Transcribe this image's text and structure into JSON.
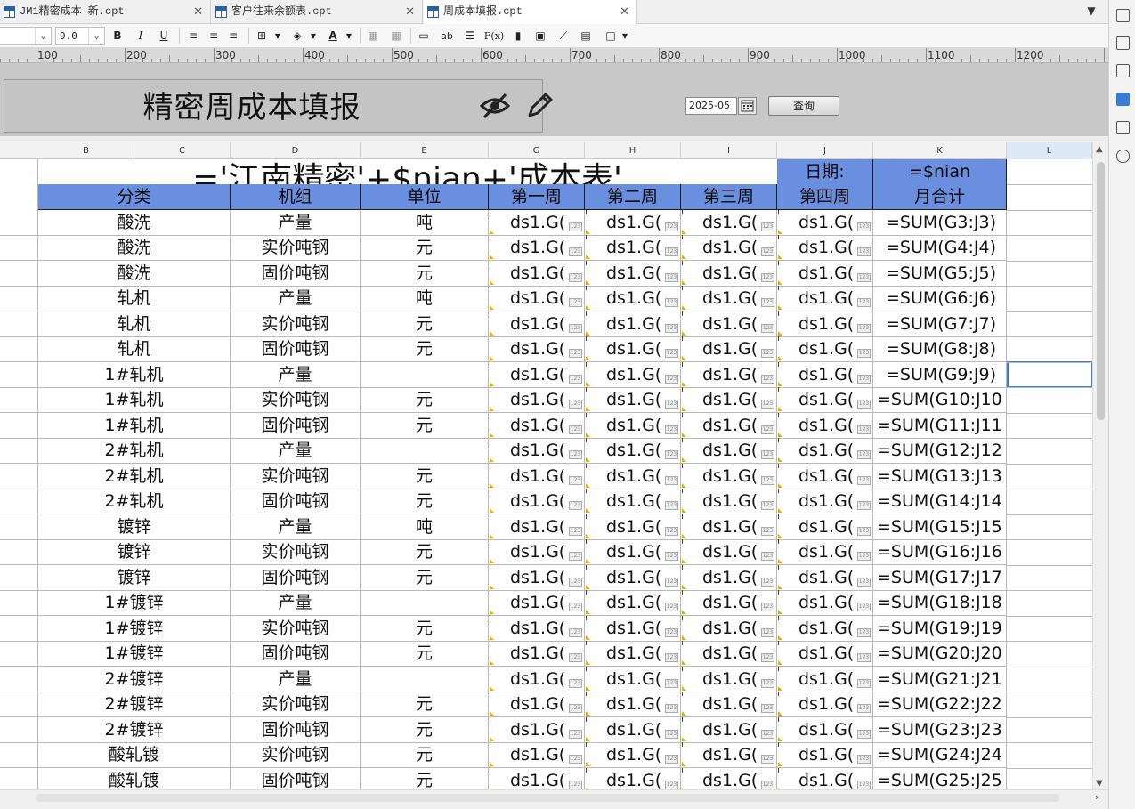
{
  "tabs": [
    {
      "label": "JM1精密成本 新.cpt",
      "close": "✕"
    },
    {
      "label": "客户往来余额表.cpt",
      "close": "✕"
    },
    {
      "label": "周成本填报.cpt",
      "close": "✕"
    }
  ],
  "toolbar": {
    "font_size": "9.0",
    "bold": "B",
    "italic": "I",
    "underline": "U",
    "font_color": "A",
    "text_ab": "ab",
    "formula": "F(x)"
  },
  "ruler": [
    "100",
    "200",
    "300",
    "400",
    "500",
    "600",
    "700",
    "800",
    "900",
    "1000",
    "1100",
    "1200"
  ],
  "param": {
    "title": "精密周成本填报",
    "date_value": "2025-05",
    "query_label": "查询"
  },
  "columns": [
    "B",
    "C",
    "D",
    "E",
    "G",
    "H",
    "I",
    "J",
    "K",
    "L"
  ],
  "sheet": {
    "title_formula": "='江南精密'+$nian+'成本表'",
    "date_label": "日期:",
    "date_formula": "=$nian",
    "headers": [
      "分类",
      "机组",
      "单位",
      "第一周",
      "第二周",
      "第三周",
      "第四周",
      "月合计"
    ],
    "cell_value": "ds1.G(",
    "badge": "123",
    "rows": [
      {
        "cat": "酸洗",
        "item": "产量",
        "unit": "吨",
        "sum": "=SUM(G3:J3)"
      },
      {
        "cat": "酸洗",
        "item": "实价吨钢",
        "unit": "元",
        "sum": "=SUM(G4:J4)"
      },
      {
        "cat": "酸洗",
        "item": "固价吨钢",
        "unit": "元",
        "sum": "=SUM(G5:J5)"
      },
      {
        "cat": "轧机",
        "item": "产量",
        "unit": "吨",
        "sum": "=SUM(G6:J6)"
      },
      {
        "cat": "轧机",
        "item": "实价吨钢",
        "unit": "元",
        "sum": "=SUM(G7:J7)"
      },
      {
        "cat": "轧机",
        "item": "固价吨钢",
        "unit": "元",
        "sum": "=SUM(G8:J8)"
      },
      {
        "cat": "1#轧机",
        "item": "产量",
        "unit": "",
        "sum": "=SUM(G9:J9)"
      },
      {
        "cat": "1#轧机",
        "item": "实价吨钢",
        "unit": "元",
        "sum": "=SUM(G10:J10"
      },
      {
        "cat": "1#轧机",
        "item": "固价吨钢",
        "unit": "元",
        "sum": "=SUM(G11:J11"
      },
      {
        "cat": "2#轧机",
        "item": "产量",
        "unit": "",
        "sum": "=SUM(G12:J12"
      },
      {
        "cat": "2#轧机",
        "item": "实价吨钢",
        "unit": "元",
        "sum": "=SUM(G13:J13"
      },
      {
        "cat": "2#轧机",
        "item": "固价吨钢",
        "unit": "元",
        "sum": "=SUM(G14:J14"
      },
      {
        "cat": "镀锌",
        "item": "产量",
        "unit": "吨",
        "sum": "=SUM(G15:J15"
      },
      {
        "cat": "镀锌",
        "item": "实价吨钢",
        "unit": "元",
        "sum": "=SUM(G16:J16"
      },
      {
        "cat": "镀锌",
        "item": "固价吨钢",
        "unit": "元",
        "sum": "=SUM(G17:J17"
      },
      {
        "cat": "1#镀锌",
        "item": "产量",
        "unit": "",
        "sum": "=SUM(G18:J18"
      },
      {
        "cat": "1#镀锌",
        "item": "实价吨钢",
        "unit": "元",
        "sum": "=SUM(G19:J19"
      },
      {
        "cat": "1#镀锌",
        "item": "固价吨钢",
        "unit": "元",
        "sum": "=SUM(G20:J20"
      },
      {
        "cat": "2#镀锌",
        "item": "产量",
        "unit": "",
        "sum": "=SUM(G21:J21"
      },
      {
        "cat": "2#镀锌",
        "item": "实价吨钢",
        "unit": "元",
        "sum": "=SUM(G22:J22"
      },
      {
        "cat": "2#镀锌",
        "item": "固价吨钢",
        "unit": "元",
        "sum": "=SUM(G23:J23"
      },
      {
        "cat": "酸轧镀",
        "item": "实价吨钢",
        "unit": "元",
        "sum": "=SUM(G24:J24"
      },
      {
        "cat": "酸轧镀",
        "item": "固价吨钢",
        "unit": "元",
        "sum": "=SUM(G25:J25"
      }
    ]
  },
  "colors": {
    "header_fill": "#6b8fe0",
    "selection": "#3a7bd5"
  }
}
